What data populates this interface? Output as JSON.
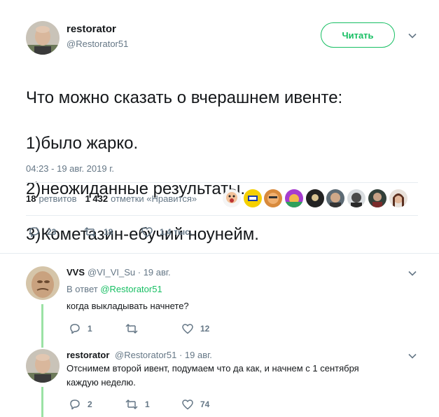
{
  "tweet": {
    "author_name": "restorator",
    "author_handle": "@Restorator51",
    "follow_label": "Читать",
    "lines": [
      "Что можно сказать о вчерашнем ивенте:",
      "1)было жарко.",
      "2)неожиданные результаты.",
      "3)Кометазин-ебучий ноунейм."
    ],
    "timestamp": "04:23 - 19 авг. 2019 г.",
    "retweets_count": "18",
    "retweets_label": "ретвитов",
    "likes_count": "1 432",
    "likes_label": "отметки «Нравится»",
    "reply_count": "23",
    "retweet_action_count": "18",
    "like_action_count": "1,4 тыс."
  },
  "replies": [
    {
      "name": "VVS",
      "handle": "@VI_VI_Su",
      "date": "19 авг.",
      "reply_to_label": "В ответ",
      "reply_to_handle": "@Restorator51",
      "text": "когда выкладывать начнете?",
      "reply_count": "1",
      "retweet_count": "",
      "like_count": "12"
    },
    {
      "name": "restorator",
      "handle": "@Restorator51",
      "date": "19 авг.",
      "text": "Отснимем второй ивент, подумаем что да как, и начнем с 1 сентября каждую неделю.",
      "reply_count": "2",
      "retweet_count": "1",
      "like_count": "74"
    }
  ],
  "colors": {
    "accent": "#17bf63",
    "thread_line": "#9be2a4",
    "secondary_text": "#657786",
    "divider": "#e6ecf0"
  }
}
